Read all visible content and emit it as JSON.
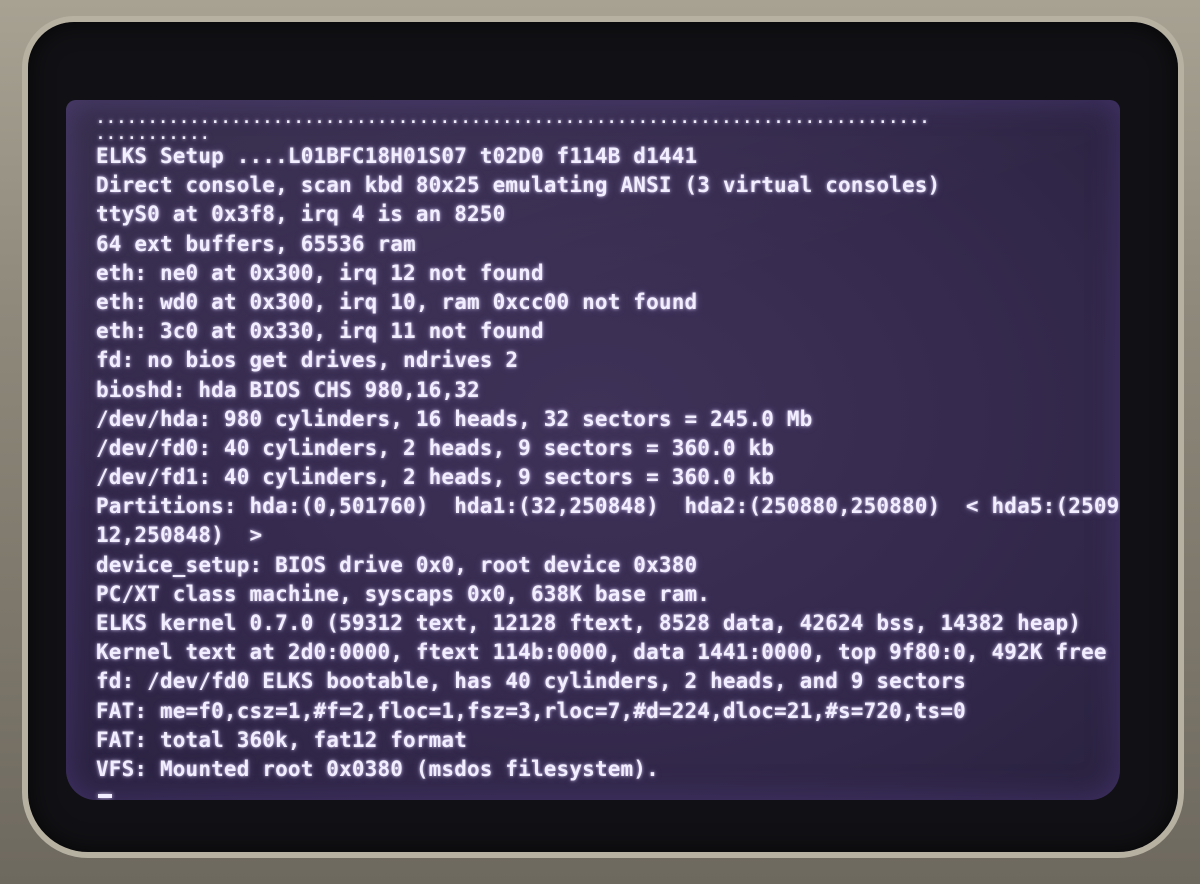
{
  "console": {
    "dots": [
      "................................................................................",
      "..........."
    ],
    "lines": [
      "ELKS Setup ....L01BFC18H01S07 t02D0 f114B d1441",
      "Direct console, scan kbd 80x25 emulating ANSI (3 virtual consoles)",
      "ttyS0 at 0x3f8, irq 4 is an 8250",
      "64 ext buffers, 65536 ram",
      "eth: ne0 at 0x300, irq 12 not found",
      "eth: wd0 at 0x300, irq 10, ram 0xcc00 not found",
      "eth: 3c0 at 0x330, irq 11 not found",
      "fd: no bios get drives, ndrives 2",
      "bioshd: hda BIOS CHS 980,16,32",
      "/dev/hda: 980 cylinders, 16 heads, 32 sectors = 245.0 Mb",
      "/dev/fd0: 40 cylinders, 2 heads, 9 sectors = 360.0 kb",
      "/dev/fd1: 40 cylinders, 2 heads, 9 sectors = 360.0 kb",
      "Partitions: hda:(0,501760)  hda1:(32,250848)  hda2:(250880,250880)  < hda5:(2509",
      "12,250848)  >",
      "device_setup: BIOS drive 0x0, root device 0x380",
      "PC/XT class machine, syscaps 0x0, 638K base ram.",
      "ELKS kernel 0.7.0 (59312 text, 12128 ftext, 8528 data, 42624 bss, 14382 heap)",
      "Kernel text at 2d0:0000, ftext 114b:0000, data 1441:0000, top 9f80:0, 492K free",
      "fd: /dev/fd0 ELKS bootable, has 40 cylinders, 2 heads, and 9 sectors",
      "FAT: me=f0,csz=1,#f=2,floc=1,fsz=3,rloc=7,#d=224,dloc=21,#s=720,ts=0",
      "FAT: total 360k, fat12 format",
      "VFS: Mounted root 0x0380 (msdos filesystem)."
    ]
  }
}
